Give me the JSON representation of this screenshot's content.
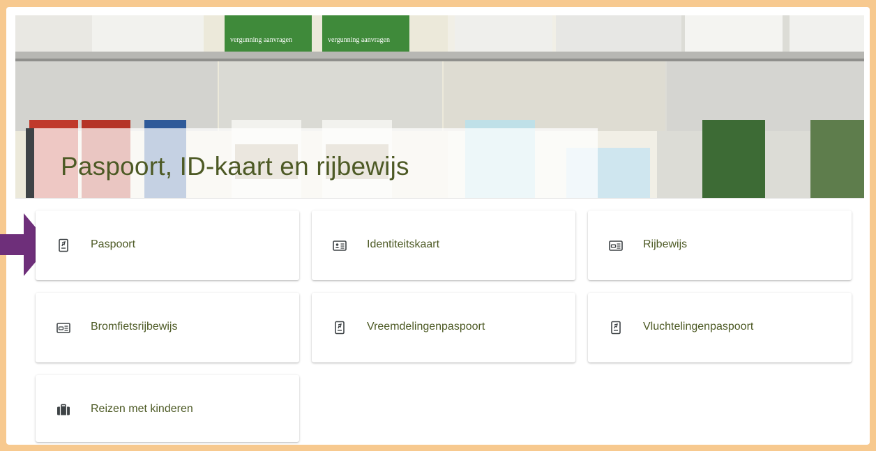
{
  "page": {
    "title": "Paspoort, ID-kaart en rijbewijs"
  },
  "tiles": [
    {
      "label": "Paspoort",
      "icon": "passport-icon"
    },
    {
      "label": "Identiteitskaart",
      "icon": "id-card-icon"
    },
    {
      "label": "Rijbewijs",
      "icon": "drivers-license-icon"
    },
    {
      "label": "Bromfietsrijbewijs",
      "icon": "drivers-license-icon"
    },
    {
      "label": "Vreemdelingenpaspoort",
      "icon": "passport-icon"
    },
    {
      "label": "Vluchtelingenpaspoort",
      "icon": "passport-icon"
    },
    {
      "label": "Reizen met kinderen",
      "icon": "suitcase-icon"
    }
  ],
  "hero": {
    "brochure_texts": [
      "vergunning aanvragen",
      "vergunning aanvragen"
    ]
  },
  "colors": {
    "frame": "#f7c98f",
    "title_text": "#4d5a25",
    "arrow": "#6e2f7a",
    "title_accent": "#3e4346"
  }
}
